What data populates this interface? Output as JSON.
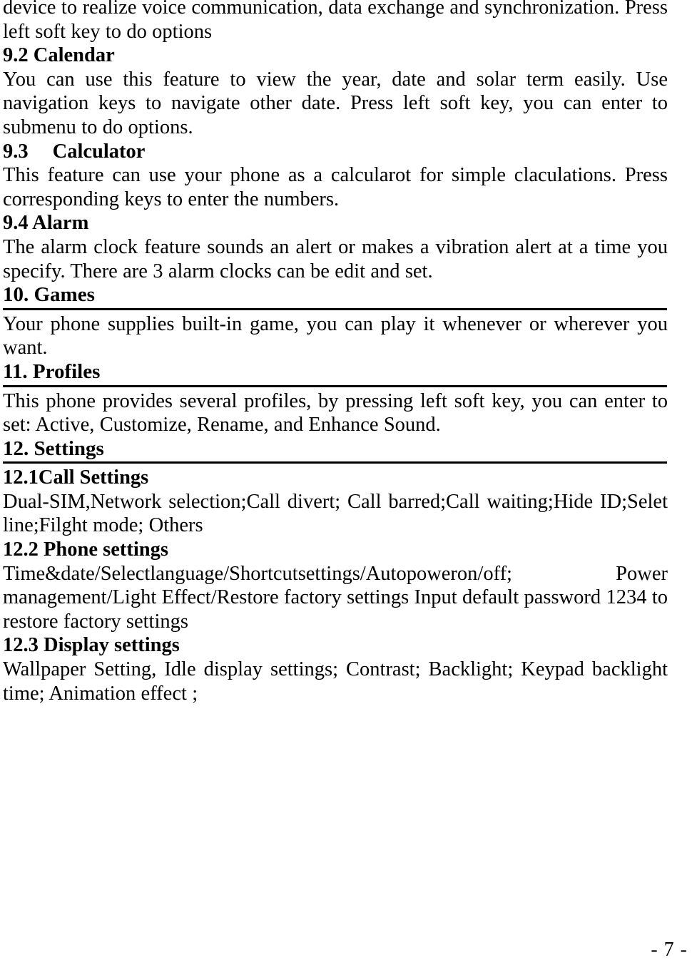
{
  "document": {
    "page_label": "- 7 -",
    "blocks": [
      {
        "type": "paragraph",
        "name": "paragraph-bluetooth-continued",
        "text": "device to realize voice communication, data exchange and synchronization. Press left soft key to do options"
      },
      {
        "type": "heading",
        "name": "heading-9-2-calendar",
        "level": 2,
        "text": "9.2 Calendar"
      },
      {
        "type": "paragraph",
        "name": "paragraph-calendar",
        "text": "You can use this feature to view the year, date and solar term easily. Use navigation keys to navigate other date. Press left soft key, you can enter to submenu to do options."
      },
      {
        "type": "heading-tabbed",
        "name": "heading-9-3-calculator",
        "level": 2,
        "number": "9.3",
        "title": "Calculator"
      },
      {
        "type": "paragraph",
        "name": "paragraph-calculator",
        "text": "This feature can use your phone as a calcularot for simple claculations. Press corresponding keys to enter the numbers."
      },
      {
        "type": "heading",
        "name": "heading-9-4-alarm",
        "level": 2,
        "text": "9.4 Alarm"
      },
      {
        "type": "paragraph",
        "name": "paragraph-alarm",
        "text": "The alarm clock feature sounds an alert or makes a vibration alert at a time you specify. There are 3 alarm clocks can be edit and set."
      },
      {
        "type": "heading",
        "name": "heading-10-games",
        "level": 1,
        "text": "10. Games",
        "rule_below": true
      },
      {
        "type": "paragraph",
        "name": "paragraph-games",
        "text": "Your phone supplies built-in game, you can play it whenever or wherever you want."
      },
      {
        "type": "heading",
        "name": "heading-11-profiles",
        "level": 1,
        "text": "11. Profiles",
        "rule_below": true
      },
      {
        "type": "paragraph",
        "name": "paragraph-profiles",
        "text": "This phone provides several profiles, by pressing left soft key, you can enter to set: Active, Customize, Rename, and Enhance Sound."
      },
      {
        "type": "heading",
        "name": "heading-12-settings",
        "level": 1,
        "text": "12. Settings",
        "rule_below": true
      },
      {
        "type": "heading",
        "name": "heading-12-1-call-settings",
        "level": 2,
        "text": "12.1Call Settings"
      },
      {
        "type": "paragraph",
        "name": "paragraph-call-settings",
        "text": "Dual-SIM,Network selection;Call divert; Call barred;Call waiting;Hide ID;Selet line;Filght mode; Others"
      },
      {
        "type": "heading",
        "name": "heading-12-2-phone-settings",
        "level": 2,
        "text": "12.2 Phone settings"
      },
      {
        "type": "paragraph",
        "name": "paragraph-phone-settings",
        "text": "Time&date/Selectlanguage/Shortcutsettings/Autopoweron/off; Power management/Light Effect/Restore factory settings Input default password 1234 to restore factory settings"
      },
      {
        "type": "heading",
        "name": "heading-12-3-display-settings",
        "level": 2,
        "text": "12.3 Display settings"
      },
      {
        "type": "paragraph",
        "name": "paragraph-display-settings",
        "text": "Wallpaper Setting, Idle display settings; Contrast; Backlight; Keypad backlight time; Animation effect ;"
      }
    ]
  }
}
